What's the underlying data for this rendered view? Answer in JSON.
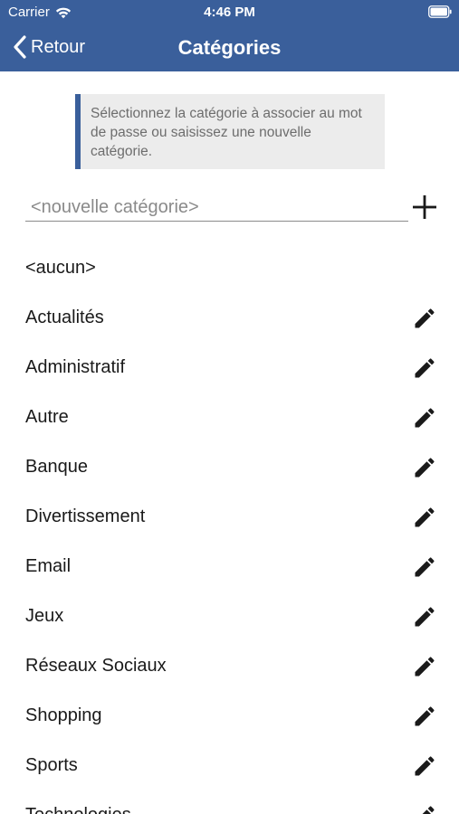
{
  "status_bar": {
    "carrier": "Carrier",
    "time": "4:46 PM"
  },
  "nav": {
    "back_label": "Retour",
    "title": "Catégories"
  },
  "info_text": "Sélectionnez la catégorie à associer au mot de passe ou saisissez une nouvelle catégorie.",
  "new_category": {
    "placeholder": "<nouvelle catégorie>",
    "value": ""
  },
  "categories": [
    {
      "label": "<aucun>",
      "editable": false
    },
    {
      "label": "Actualités",
      "editable": true
    },
    {
      "label": "Administratif",
      "editable": true
    },
    {
      "label": "Autre",
      "editable": true
    },
    {
      "label": "Banque",
      "editable": true
    },
    {
      "label": "Divertissement",
      "editable": true
    },
    {
      "label": "Email",
      "editable": true
    },
    {
      "label": "Jeux",
      "editable": true
    },
    {
      "label": "Réseaux Sociaux",
      "editable": true
    },
    {
      "label": "Shopping",
      "editable": true
    },
    {
      "label": "Sports",
      "editable": true
    },
    {
      "label": "Technologies",
      "editable": true
    }
  ],
  "icons": {
    "back": "chevron-left-icon",
    "add": "plus-icon",
    "edit": "pencil-icon",
    "wifi": "wifi-icon",
    "battery": "battery-icon"
  },
  "colors": {
    "header": "#3a5f9b",
    "info_background": "#ececec",
    "info_accent": "#3a5f9b",
    "text": "#1a1a1a",
    "muted_text": "#6d6d6d"
  }
}
